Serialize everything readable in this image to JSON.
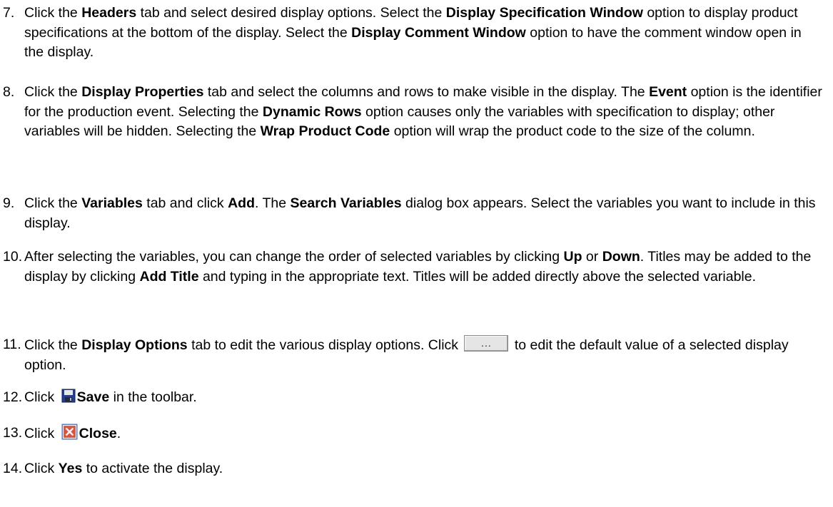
{
  "steps": [
    {
      "number": "7.",
      "parts": [
        "Click the ",
        "Headers",
        " tab and select desired display options. Select the ",
        "Display Specification Window",
        " option to display product specifications at the bottom of the display. Select the ",
        "Display Comment Window",
        " option to have the comment window open in the display."
      ]
    },
    {
      "number": "8.",
      "parts": [
        "Click the ",
        "Display Properties",
        " tab and select the columns and rows to make visible in the display. The ",
        "Event",
        " option is the identifier for the production event. Selecting the ",
        "Dynamic Rows",
        " option causes only the variables with specification to display; other variables will be hidden. Selecting the ",
        "Wrap Product Code",
        " option will wrap the product code to the size of the column."
      ]
    },
    {
      "number": "9.",
      "parts": [
        "Click the ",
        "Variables",
        " tab and click ",
        "Add",
        ". The ",
        "Search Variables",
        " dialog box appears. Select the variables you want to include in this display."
      ]
    },
    {
      "number": "10.",
      "parts": [
        "After selecting the variables, you can change the order of selected variables by clicking ",
        "Up",
        " or ",
        "Down",
        ". Titles may be added to the display by clicking ",
        "Add Title",
        " and typing in the appropriate text. Titles will be added directly above the selected variable."
      ]
    },
    {
      "number": "11.",
      "parts": [
        "Click the ",
        "Display Options",
        " tab to edit the various display options. Click ",
        " to edit the default value of a selected display option."
      ],
      "button_label": "..."
    },
    {
      "number": "12.",
      "parts": [
        "Click ",
        "Save",
        " in the toolbar."
      ]
    },
    {
      "number": "13.",
      "parts": [
        "Click ",
        "Close",
        "."
      ]
    },
    {
      "number": "14.",
      "parts": [
        "Click ",
        "Yes",
        " to activate the display."
      ]
    }
  ],
  "icons": {
    "save_icon": "save-floppy-icon",
    "close_icon": "close-x-icon",
    "ellipsis_button": "ellipsis-button"
  },
  "colors": {
    "text": "#000000",
    "close_icon_red": "#e0503a",
    "save_icon_blue": "#1f3f9c"
  }
}
